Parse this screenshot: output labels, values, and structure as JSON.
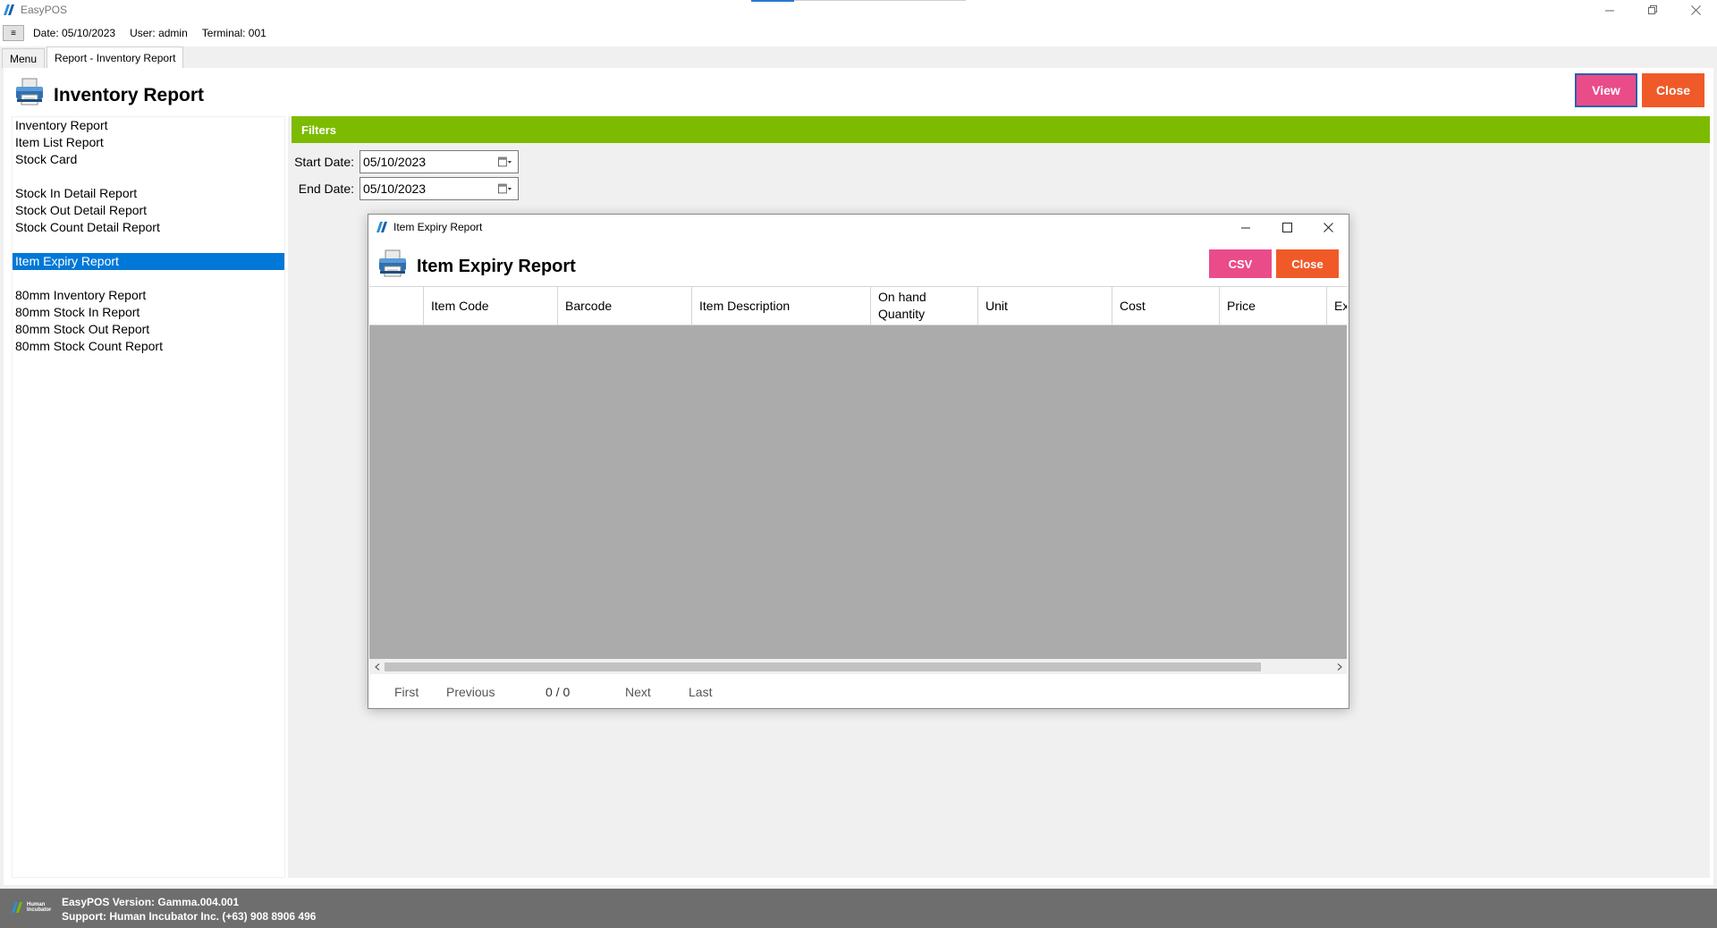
{
  "app": {
    "title": "EasyPOS"
  },
  "infobar": {
    "menu_toggle": "≡",
    "date": "Date: 05/10/2023",
    "user": "User: admin",
    "terminal": "Terminal: 001"
  },
  "tabs": [
    {
      "label": "Menu"
    },
    {
      "label": "Report - Inventory Report"
    }
  ],
  "page": {
    "title": "Inventory Report",
    "view_label": "View",
    "close_label": "Close"
  },
  "sidebar": {
    "items": [
      {
        "label": "Inventory Report"
      },
      {
        "label": "Item List Report"
      },
      {
        "label": "Stock Card"
      },
      {
        "label": "Stock In Detail Report"
      },
      {
        "label": "Stock Out Detail Report"
      },
      {
        "label": "Stock Count Detail Report"
      },
      {
        "label": "Item Expiry Report"
      },
      {
        "label": "80mm Inventory Report"
      },
      {
        "label": "80mm Stock In Report"
      },
      {
        "label": "80mm Stock Out Report"
      },
      {
        "label": "80mm Stock Count Report"
      }
    ]
  },
  "filters": {
    "title": "Filters",
    "start_label": "Start Date:",
    "start_value": "05/10/2023",
    "end_label": "End Date:",
    "end_value": "05/10/2023"
  },
  "dialog": {
    "window_title": "Item Expiry Report",
    "title": "Item Expiry Report",
    "csv_label": "CSV",
    "close_label": "Close",
    "columns": [
      {
        "label": ""
      },
      {
        "label": "Item Code"
      },
      {
        "label": "Barcode"
      },
      {
        "label": "Item Description"
      },
      {
        "label": "On hand\nQuantity"
      },
      {
        "label": "Unit"
      },
      {
        "label": "Cost"
      },
      {
        "label": "Price"
      },
      {
        "label": "Ex"
      }
    ],
    "pager": {
      "first": "First",
      "previous": "Previous",
      "count": "0 / 0",
      "next": "Next",
      "last": "Last"
    }
  },
  "footer": {
    "logo_text": "Human Incubator",
    "version": "EasyPOS Version: Gamma.004.001",
    "support": "Support: Human Incubator Inc. (+63) 908 8906 496"
  },
  "colors": {
    "pink": "#ea4c89",
    "orange": "#f05a28",
    "green": "#7dbb00",
    "selected": "#0078d7"
  }
}
